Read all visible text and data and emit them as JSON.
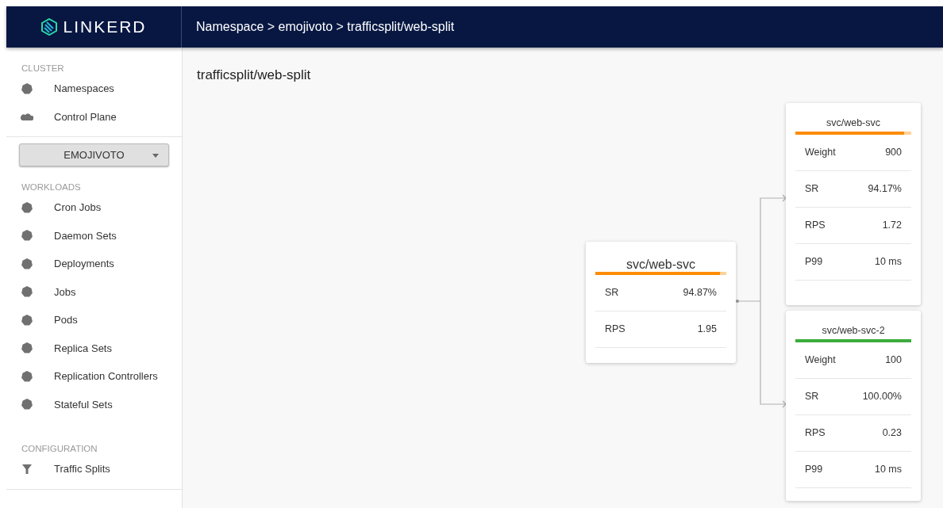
{
  "header": {
    "logo_text": "LINKERD",
    "breadcrumb": "Namespace > emojivoto > trafficsplit/web-split"
  },
  "sidebar": {
    "cluster": {
      "title": "CLUSTER",
      "items": [
        {
          "label": "Namespaces"
        },
        {
          "label": "Control Plane"
        }
      ]
    },
    "namespace_select": {
      "value": "EMOJIVOTO"
    },
    "workloads": {
      "title": "WORKLOADS",
      "items": [
        {
          "label": "Cron Jobs"
        },
        {
          "label": "Daemon Sets"
        },
        {
          "label": "Deployments"
        },
        {
          "label": "Jobs"
        },
        {
          "label": "Pods"
        },
        {
          "label": "Replica Sets"
        },
        {
          "label": "Replication Controllers"
        },
        {
          "label": "Stateful Sets"
        }
      ]
    },
    "configuration": {
      "title": "CONFIGURATION",
      "items": [
        {
          "label": "Traffic Splits"
        }
      ]
    }
  },
  "page_title": "trafficsplit/web-split",
  "graph": {
    "source": {
      "title": "svc/web-svc",
      "bar": {
        "level": 0.9487,
        "color": "#ff8c00"
      },
      "rows": [
        {
          "label": "SR",
          "value": "94.87%"
        },
        {
          "label": "RPS",
          "value": "1.95"
        }
      ]
    },
    "targets": [
      {
        "title": "svc/web-svc",
        "bar": {
          "level": 0.9417,
          "color": "#ff8c00"
        },
        "rows": [
          {
            "label": "Weight",
            "value": "900"
          },
          {
            "label": "SR",
            "value": "94.17%"
          },
          {
            "label": "RPS",
            "value": "1.72"
          },
          {
            "label": "P99",
            "value": "10 ms"
          }
        ]
      },
      {
        "title": "svc/web-svc-2",
        "bar": {
          "level": 1,
          "color": "#3cac3c"
        },
        "rows": [
          {
            "label": "Weight",
            "value": "100"
          },
          {
            "label": "SR",
            "value": "100.00%"
          },
          {
            "label": "RPS",
            "value": "0.23"
          },
          {
            "label": "P99",
            "value": "10 ms"
          }
        ]
      }
    ]
  }
}
